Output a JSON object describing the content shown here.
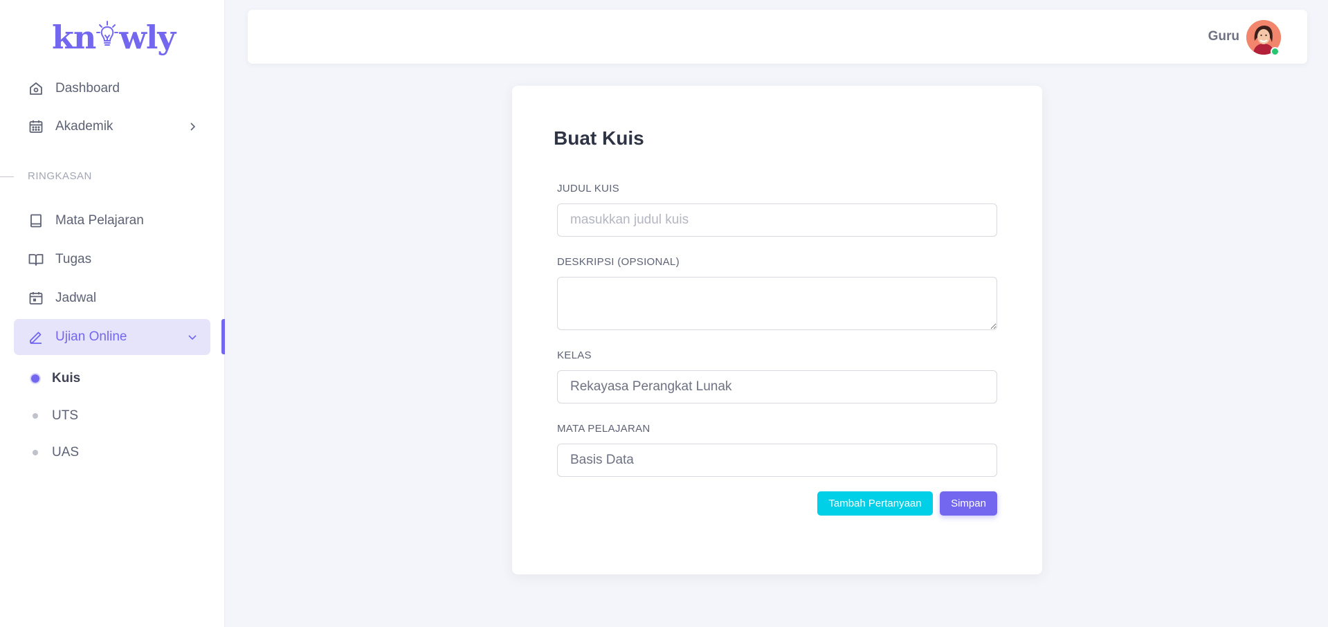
{
  "brand": {
    "logo_left": "kn",
    "logo_right": "wly",
    "color": "#7367f0"
  },
  "sidebar": {
    "items": [
      {
        "label": "Dashboard",
        "icon": "home-icon"
      },
      {
        "label": "Akademik",
        "icon": "calendar-grid-icon"
      }
    ],
    "section_label": "RINGKASAN",
    "summary_items": [
      {
        "label": "Mata Pelajaran",
        "icon": "book-icon"
      },
      {
        "label": "Tugas",
        "icon": "open-book-icon"
      },
      {
        "label": "Jadwal",
        "icon": "calendar-icon"
      },
      {
        "label": "Ujian Online",
        "icon": "pencil-icon",
        "active": true
      }
    ],
    "sub_items": [
      {
        "label": "Kuis",
        "current": true
      },
      {
        "label": "UTS"
      },
      {
        "label": "UAS"
      }
    ]
  },
  "header": {
    "user_name": "Guru",
    "status_color": "#28c76f"
  },
  "form": {
    "title": "Buat Kuis",
    "judul_label": "JUDUL KUIS",
    "judul_placeholder": "masukkan judul kuis",
    "judul_value": "",
    "deskripsi_label": "DESKRIPSI (OPSIONAL)",
    "deskripsi_value": "",
    "kelas_label": "KELAS",
    "kelas_value": "Rekayasa Perangkat Lunak",
    "mapel_label": "MATA PELAJARAN",
    "mapel_value": "Basis Data",
    "add_question_label": "Tambah Pertanyaan",
    "save_label": "Simpan"
  }
}
